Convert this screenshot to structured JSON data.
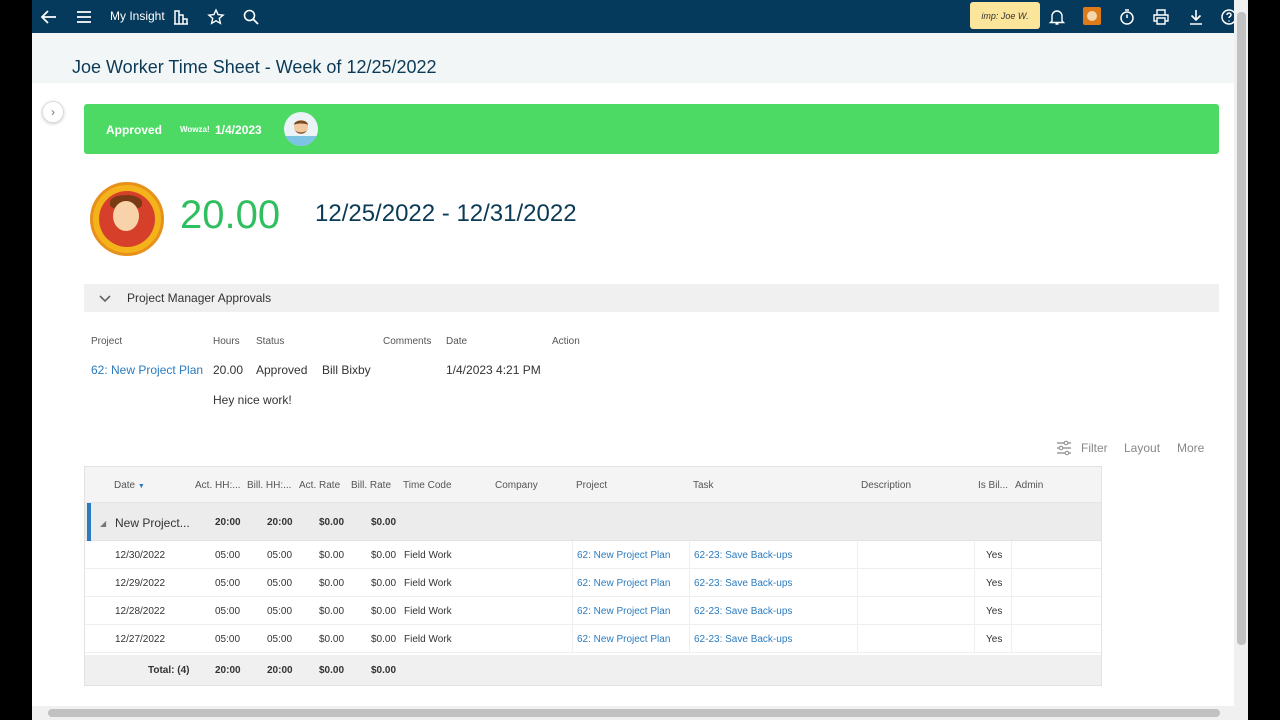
{
  "topbar": {
    "title": "My Insight",
    "impersonation": "imp: Joe W."
  },
  "page": {
    "title": "Joe Worker Time Sheet - Week of 12/25/2022"
  },
  "approval": {
    "status": "Approved",
    "by": "Wowza!",
    "date": "1/4/2023"
  },
  "summary": {
    "hours": "20.00",
    "range": "12/25/2022 - 12/31/2022"
  },
  "pm": {
    "title": "Project Manager Approvals",
    "columns": [
      "Project",
      "Hours",
      "Status",
      "Comments",
      "Date",
      "Action"
    ],
    "row": {
      "project": "62: New Project Plan",
      "hours": "20.00",
      "status": "Approved",
      "manager": "Bill Bixby",
      "date": "1/4/2023 4:21 PM",
      "comment": "Hey nice work!"
    }
  },
  "toolbar": {
    "filter": "Filter",
    "layout": "Layout",
    "more": "More"
  },
  "grid": {
    "headers": {
      "date": "Date",
      "act_hh": "Act. HH:...",
      "bill_hh": "Bill. HH:...",
      "act_rate": "Act. Rate",
      "bill_rate": "Bill. Rate",
      "time_code": "Time Code",
      "company": "Company",
      "project": "Project",
      "task": "Task",
      "description": "Description",
      "is_billable": "Is Bil...",
      "admin": "Admin"
    },
    "group": {
      "name": "New Project...",
      "act_hh": "20:00",
      "bill_hh": "20:00",
      "act_rate": "$0.00",
      "bill_rate": "$0.00"
    },
    "rows": [
      {
        "date": "12/30/2022",
        "act_hh": "05:00",
        "bill_hh": "05:00",
        "act_rate": "$0.00",
        "bill_rate": "$0.00",
        "time_code": "Field Work",
        "project": "62: New Project Plan",
        "task": "62-23: Save Back-ups",
        "is_billable": "Yes"
      },
      {
        "date": "12/29/2022",
        "act_hh": "05:00",
        "bill_hh": "05:00",
        "act_rate": "$0.00",
        "bill_rate": "$0.00",
        "time_code": "Field Work",
        "project": "62: New Project Plan",
        "task": "62-23: Save Back-ups",
        "is_billable": "Yes"
      },
      {
        "date": "12/28/2022",
        "act_hh": "05:00",
        "bill_hh": "05:00",
        "act_rate": "$0.00",
        "bill_rate": "$0.00",
        "time_code": "Field Work",
        "project": "62: New Project Plan",
        "task": "62-23: Save Back-ups",
        "is_billable": "Yes"
      },
      {
        "date": "12/27/2022",
        "act_hh": "05:00",
        "bill_hh": "05:00",
        "act_rate": "$0.00",
        "bill_rate": "$0.00",
        "time_code": "Field Work",
        "project": "62: New Project Plan",
        "task": "62-23: Save Back-ups",
        "is_billable": "Yes"
      }
    ],
    "total": {
      "label": "Total: (4)",
      "act_hh": "20:00",
      "bill_hh": "20:00",
      "act_rate": "$0.00",
      "bill_rate": "$0.00"
    }
  },
  "colors": {
    "topbar": "#063a5c",
    "banner": "#4cd964",
    "hours": "#2fbf5f",
    "link": "#2a7bbf"
  }
}
